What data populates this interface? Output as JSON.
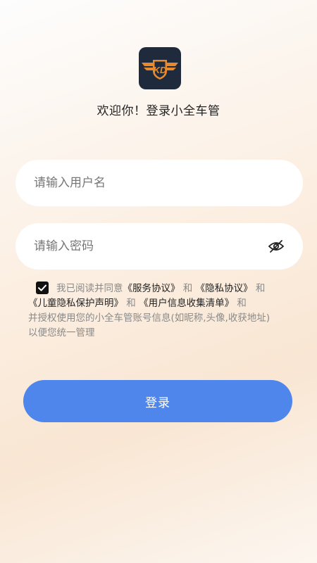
{
  "app": {
    "logo_text": "KD",
    "welcome": "欢迎你！登录小全车管"
  },
  "form": {
    "username_placeholder": "请输入用户名",
    "username_value": "",
    "password_placeholder": "请输入密码",
    "password_value": "",
    "password_toggle_icon": "eye-off-icon"
  },
  "agreement": {
    "checked": true,
    "line1_prefix": "我已阅读并同意",
    "service_link": "《服务协议》",
    "and1": "和",
    "privacy_link": "《隐私协议》",
    "and2": "和",
    "child_link": "《儿童隐私保护声明》",
    "and3": "和",
    "collect_link": "《用户信息收集清单》",
    "and4": "和",
    "line3": "并授权使用您的小全车管账号信息(如昵称,头像,收获地址)",
    "line4": "以便您统一管理"
  },
  "actions": {
    "login_label": "登录"
  },
  "colors": {
    "primary": "#4f86ec",
    "logo_bg": "#1f2b3c",
    "logo_accent": "#e8892b"
  }
}
